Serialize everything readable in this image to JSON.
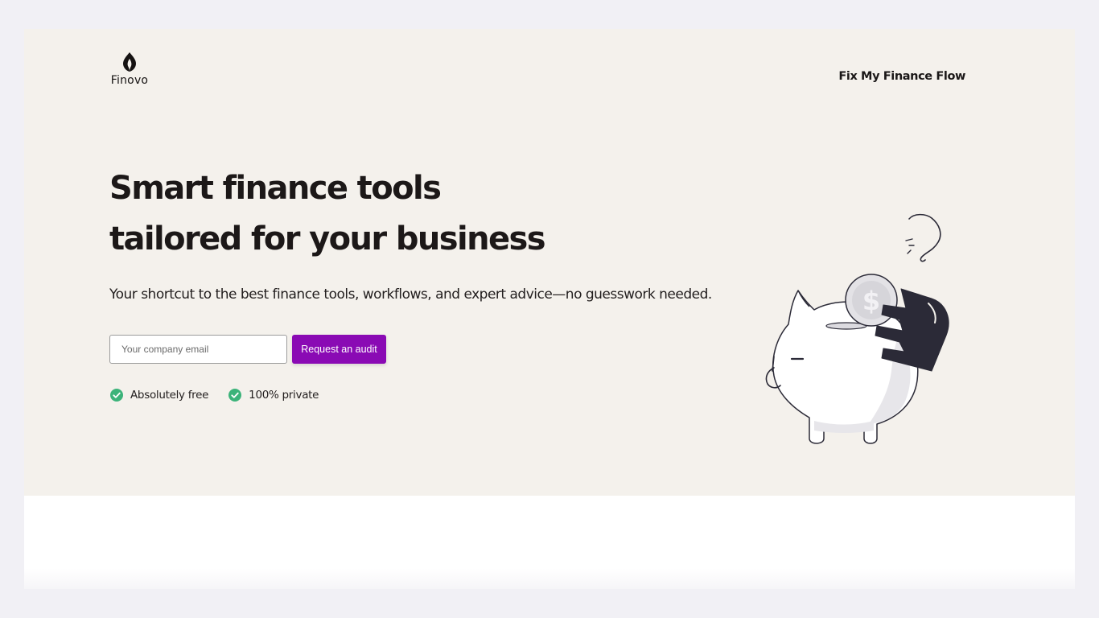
{
  "brand": {
    "name": "Finovo",
    "logo_icon": "flame-leaf-logo-icon"
  },
  "nav": {
    "cta_label": "Fix My Finance Flow"
  },
  "hero": {
    "headline_line1": "Smart finance tools",
    "headline_line2": "tailored for your business",
    "subheadline": "Your shortcut to the best finance tools, workflows, and expert advice—no guesswork needed.",
    "email": {
      "placeholder": "Your company email",
      "value": ""
    },
    "submit_label": "Request an audit",
    "badges": [
      {
        "icon": "check-circle-icon",
        "label": "Absolutely free"
      },
      {
        "icon": "check-circle-icon",
        "label": "100% private"
      }
    ],
    "illustration": "piggy-bank-with-coin-illustration"
  },
  "colors": {
    "hero_background": "#f4f1ec",
    "page_background": "#f1f0f5",
    "accent": "#8a0ab4",
    "check_green": "#3cb37a",
    "illustration_dark": "#2b2a37",
    "text": "#1c1818"
  }
}
